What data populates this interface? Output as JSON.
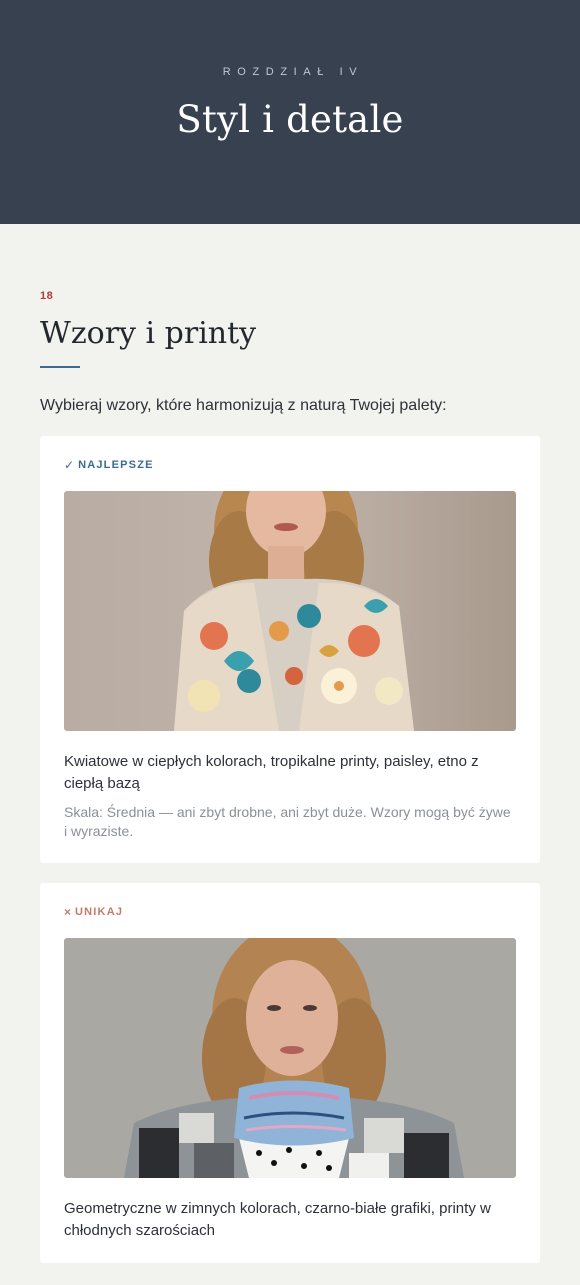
{
  "header": {
    "chapter_label": "ROZDZIAŁ IV",
    "title": "Styl i detale"
  },
  "section": {
    "number": "18",
    "title": "Wzory i printy",
    "intro": "Wybieraj wzory, które harmonizują z naturą Twojej palety:"
  },
  "cards": {
    "best": {
      "mark": "✓",
      "tag": "NAJLEPSZE",
      "icon": "check-icon",
      "description": "Kwiatowe w ciepłych kolorach, tropikalne printy, paisley, etno z ciepłą bazą",
      "note": "Skala: Średnia — ani zbyt drobne, ani zbyt duże. Wzory mogą być żywe i wyraziste."
    },
    "avoid": {
      "mark": "×",
      "tag": "UNIKAJ",
      "icon": "cross-icon",
      "description": "Geometryczne w zimnych kolorach, czarno-białe grafiki, printy w chłodnych szarościach"
    }
  },
  "colors": {
    "header_bg": "#374150",
    "page_bg": "#f2f2ee",
    "accent_blue": "#3c6b94",
    "accent_red": "#b23a3a",
    "avoid_tag": "#c87a68"
  }
}
